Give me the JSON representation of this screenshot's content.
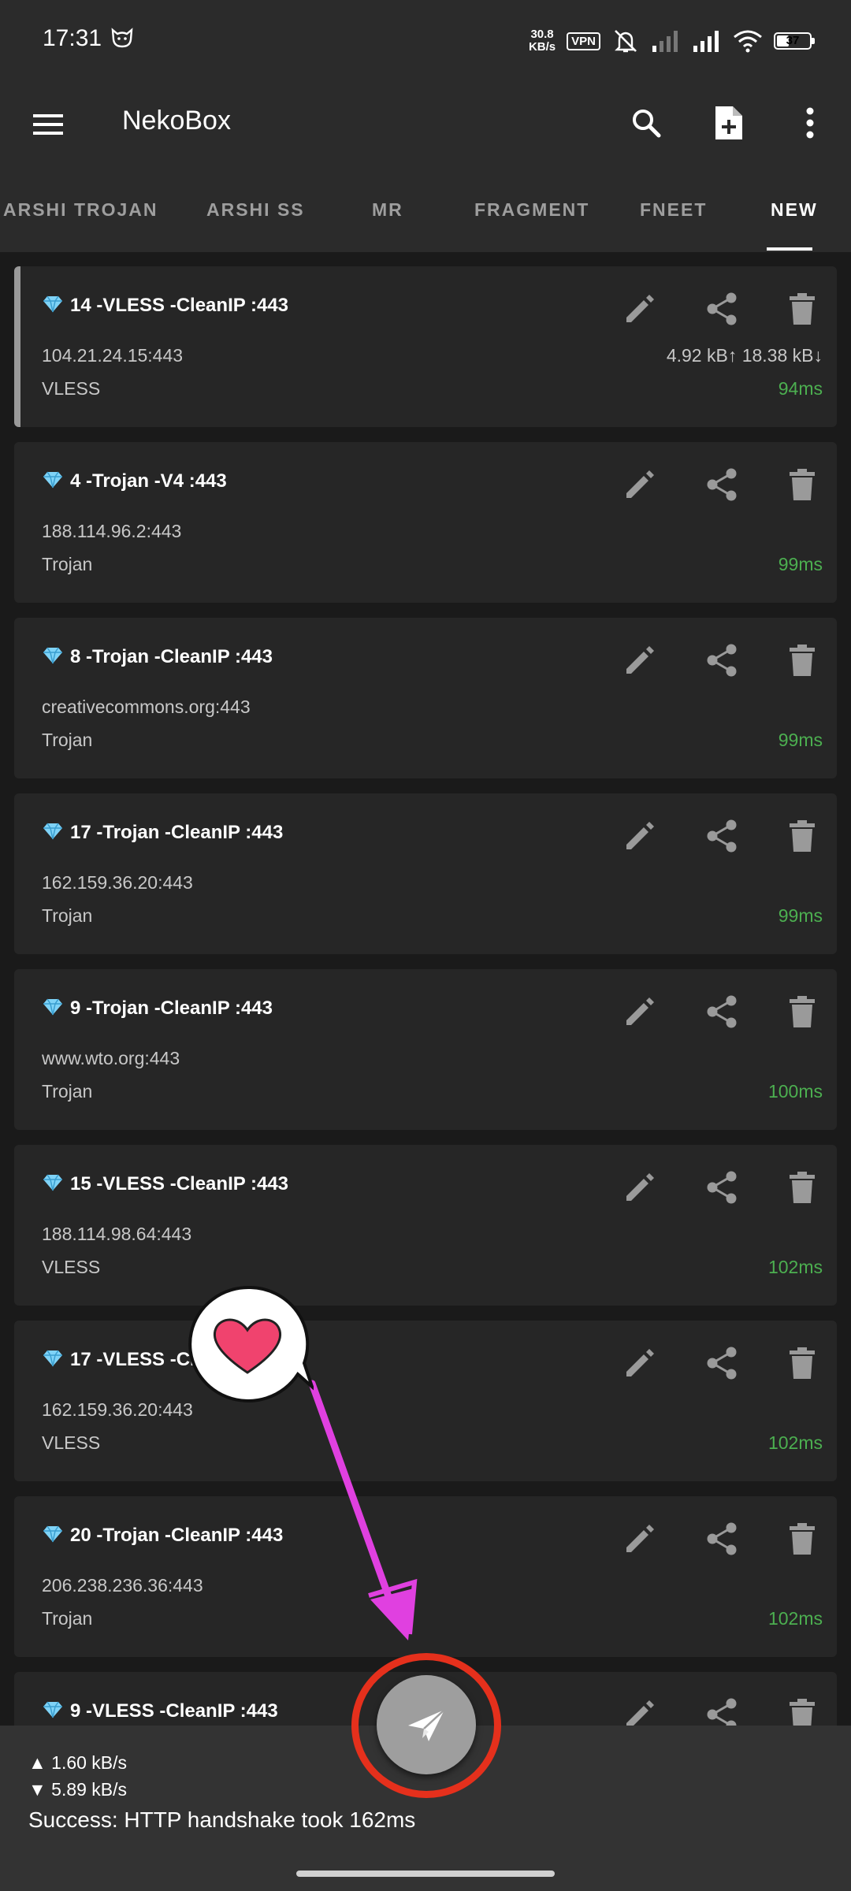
{
  "status_bar": {
    "time": "17:31",
    "net_speed_value": "30.8",
    "net_speed_unit": "KB/s",
    "vpn_label": "VPN",
    "battery": "37",
    "battery_level": 0.37
  },
  "app_bar": {
    "title": "NekoBox",
    "icons": [
      "menu-icon",
      "search-icon",
      "add-file-icon",
      "more-vert-icon"
    ]
  },
  "tabs": [
    {
      "label": "ARSHI TROJAN",
      "active": false
    },
    {
      "label": "ARSHI SS",
      "active": false
    },
    {
      "label": "MR",
      "active": false
    },
    {
      "label": "FRAGMENT",
      "active": false
    },
    {
      "label": "FNEET",
      "active": false
    },
    {
      "label": "NEW",
      "active": true
    }
  ],
  "servers": [
    {
      "name": "14 -VLESS -CleanIP :443",
      "address": "104.21.24.15:443",
      "protocol": "VLESS",
      "traffic": "4.92 kB↑ 18.38 kB↓",
      "latency": "94ms",
      "selected": true
    },
    {
      "name": "4 -Trojan -V4 :443",
      "address": "188.114.96.2:443",
      "protocol": "Trojan",
      "traffic": "",
      "latency": "99ms",
      "selected": false
    },
    {
      "name": "8 -Trojan -CleanIP :443",
      "address": "creativecommons.org:443",
      "protocol": "Trojan",
      "traffic": "",
      "latency": "99ms",
      "selected": false
    },
    {
      "name": "17 -Trojan -CleanIP :443",
      "address": "162.159.36.20:443",
      "protocol": "Trojan",
      "traffic": "",
      "latency": "99ms",
      "selected": false
    },
    {
      "name": "9 -Trojan -CleanIP :443",
      "address": "www.wto.org:443",
      "protocol": "Trojan",
      "traffic": "",
      "latency": "100ms",
      "selected": false
    },
    {
      "name": "15 -VLESS -CleanIP :443",
      "address": "188.114.98.64:443",
      "protocol": "VLESS",
      "traffic": "",
      "latency": "102ms",
      "selected": false
    },
    {
      "name": "17 -VLESS -CleanIP :443",
      "address": "162.159.36.20:443",
      "protocol": "VLESS",
      "traffic": "",
      "latency": "102ms",
      "selected": false
    },
    {
      "name": "20 -Trojan -CleanIP :443",
      "address": "206.238.236.36:443",
      "protocol": "Trojan",
      "traffic": "",
      "latency": "102ms",
      "selected": false
    },
    {
      "name": "9 -VLESS -CleanIP :443",
      "address": "",
      "protocol": "",
      "traffic": "",
      "latency": "",
      "selected": false
    }
  ],
  "bottom_bar": {
    "upload": "▲  1.60 kB/s",
    "download": "▼  5.89 kB/s",
    "status": "Success: HTTP handshake took 162ms"
  },
  "colors": {
    "background": "#1a1a1a",
    "surface": "#262626",
    "toolbar": "#2b2b2b",
    "latency_green": "#4caf50",
    "annotation_arrow": "#e040e0",
    "annotation_ring": "#e5301c",
    "heart": "#f0436e"
  }
}
